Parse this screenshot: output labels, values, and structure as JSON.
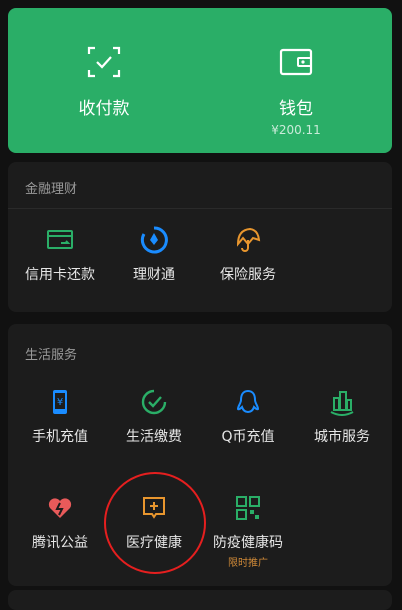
{
  "wallet": {
    "pay": {
      "label": "收付款",
      "icon": "scan-pay-icon"
    },
    "balance": {
      "label": "钱包",
      "amount": "¥200.11",
      "icon": "wallet-icon"
    }
  },
  "finance": {
    "title": "金融理财",
    "items": [
      {
        "label": "信用卡还款",
        "icon": "credit-card-icon",
        "color": "#2aae67"
      },
      {
        "label": "理财通",
        "icon": "licaitong-icon",
        "color": "#1a8cff"
      },
      {
        "label": "保险服务",
        "icon": "umbrella-icon",
        "color": "#e8962e"
      }
    ]
  },
  "life": {
    "title": "生活服务",
    "items": [
      {
        "label": "手机充值",
        "icon": "phone-yuan-icon",
        "color": "#1a8cff"
      },
      {
        "label": "生活缴费",
        "icon": "bill-check-icon",
        "color": "#2aae67"
      },
      {
        "label": "Q币充值",
        "icon": "qq-penguin-icon",
        "color": "#1a8cff"
      },
      {
        "label": "城市服务",
        "icon": "city-buildings-icon",
        "color": "#2aae67"
      },
      {
        "label": "腾讯公益",
        "icon": "charity-heart-icon",
        "color": "#e85a5a"
      },
      {
        "label": "医疗健康",
        "icon": "medical-plus-icon",
        "color": "#e8962e"
      },
      {
        "label": "防疫健康码",
        "icon": "qr-code-icon",
        "color": "#2aae67",
        "tag": "限时推广"
      }
    ]
  }
}
